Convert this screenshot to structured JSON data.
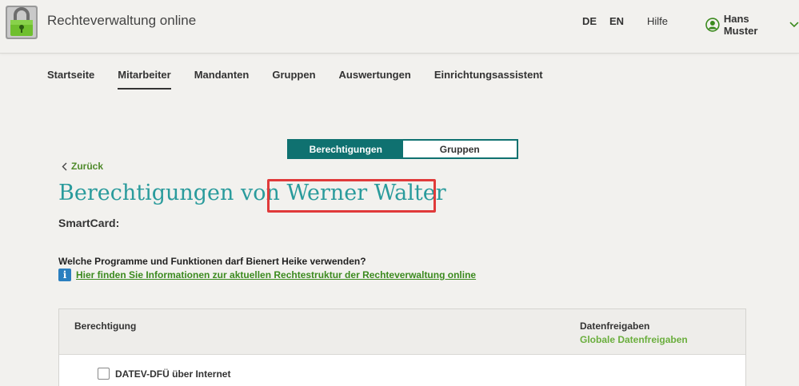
{
  "header": {
    "app_title": "Rechteverwaltung online",
    "lang_de": "DE",
    "lang_en": "EN",
    "help": "Hilfe",
    "user_name": "Hans Muster"
  },
  "nav": {
    "items": [
      {
        "label": "Startseite"
      },
      {
        "label": "Mitarbeiter"
      },
      {
        "label": "Mandanten"
      },
      {
        "label": "Gruppen"
      },
      {
        "label": "Auswertungen"
      },
      {
        "label": "Einrichtungsassistent"
      }
    ],
    "active_index": 1
  },
  "toggle": {
    "permissions": "Berechtigungen",
    "groups": "Gruppen"
  },
  "back_label": "Zurück",
  "page_title": "Berechtigungen von Werner Walter",
  "smartcard_label": "SmartCard:",
  "question": "Welche Programme und Funktionen darf Bienert Heike verwenden?",
  "info_link": "Hier finden Sie Informationen zur aktuellen Rechtestruktur der Rechteverwaltung online",
  "table": {
    "col_permission": "Berechtigung",
    "col_shares": "Datenfreigaben",
    "col_shares_sub": "Globale Datenfreigaben",
    "rows": [
      {
        "label": "DATEV-DFÜ über Internet"
      }
    ]
  },
  "colors": {
    "accent_teal": "#0f7170",
    "title_teal": "#2a9b9c",
    "link_green": "#3b8a1e",
    "highlight_red": "#e03a3a"
  }
}
